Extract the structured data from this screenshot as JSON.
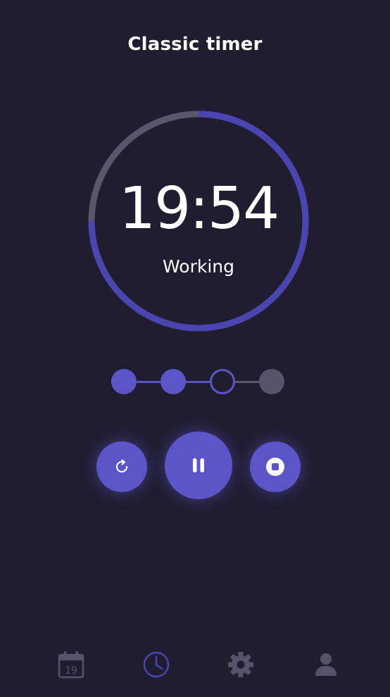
{
  "header": {
    "title": "Classic timer"
  },
  "timer": {
    "time": "19:54",
    "status": "Working",
    "progress": 0.75
  },
  "sessions": {
    "total": 4,
    "completed": 2,
    "current": 3
  },
  "controls": {
    "restart": "restart-icon",
    "pause": "pause-icon",
    "stop": "stop-icon"
  },
  "nav": {
    "items": [
      {
        "id": "calendar",
        "icon": "calendar-icon",
        "label": "19",
        "active": false
      },
      {
        "id": "timer",
        "icon": "clock-icon",
        "active": true
      },
      {
        "id": "settings",
        "icon": "gear-icon",
        "active": false
      },
      {
        "id": "profile",
        "icon": "user-icon",
        "active": false
      }
    ]
  },
  "colors": {
    "background": "#201d31",
    "accent": "#5b55c8",
    "ring_active": "#4b45b2",
    "ring_track": "#5a566c",
    "inactive": "#57546a",
    "text": "#ffffff"
  }
}
